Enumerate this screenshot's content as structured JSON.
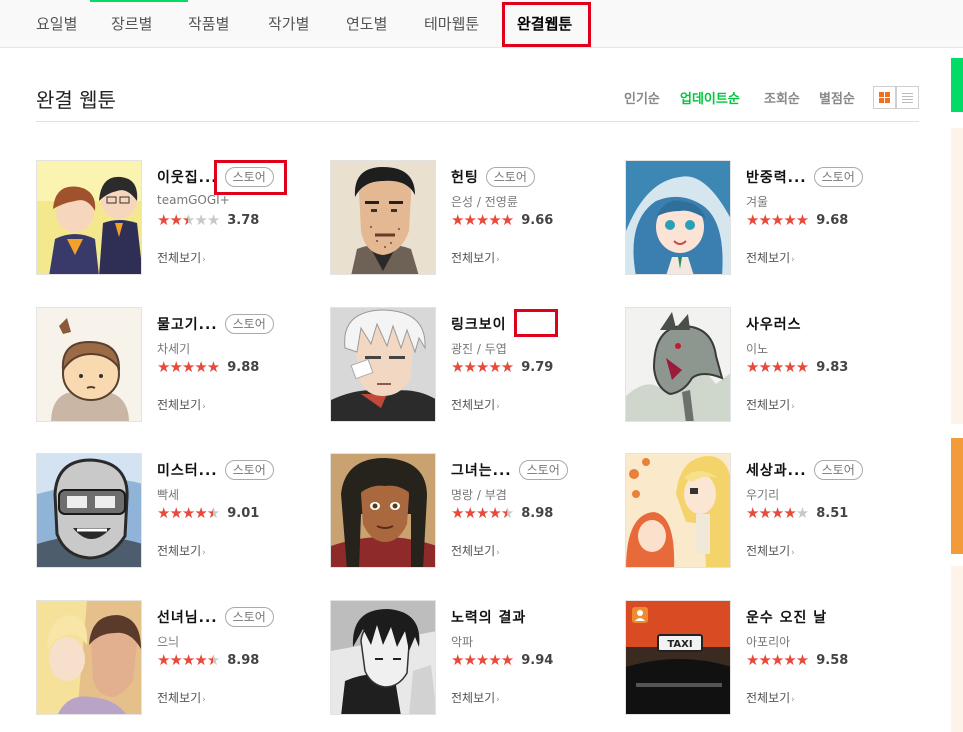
{
  "nav": {
    "tabs": [
      {
        "label": "요일별"
      },
      {
        "label": "장르별"
      },
      {
        "label": "작품별"
      },
      {
        "label": "작가별"
      },
      {
        "label": "연도별"
      },
      {
        "label": "테마웹툰"
      },
      {
        "label": "완결웹툰",
        "active": true
      }
    ],
    "accent_color": "#00dc64"
  },
  "header": {
    "title": "완결 웹툰",
    "sort_options": [
      {
        "label": "인기순"
      },
      {
        "label": "업데이트순",
        "active": true
      },
      {
        "label": "조회순"
      },
      {
        "label": "별점순"
      }
    ],
    "view_toggles": [
      "grid-view-icon",
      "list-view-icon"
    ]
  },
  "items": [
    {
      "title": "이웃집...",
      "badge": "스토어",
      "author": "teamGOGI+",
      "stars": 2.5,
      "score": "3.78",
      "view_all": "전체보기",
      "thumb": "cover-neighbors"
    },
    {
      "title": "헌팅",
      "badge": "스토어",
      "author": "은성 / 전영륜",
      "stars": 5,
      "score": "9.66",
      "view_all": "전체보기",
      "thumb": "cover-hunting"
    },
    {
      "title": "반중력...",
      "badge": "스토어",
      "author": "겨울",
      "stars": 5,
      "score": "9.68",
      "view_all": "전체보기",
      "thumb": "cover-antigravity"
    },
    {
      "title": "물고기...",
      "badge": "스토어",
      "author": "차세기",
      "stars": 5,
      "score": "9.88",
      "view_all": "전체보기",
      "thumb": "cover-fish"
    },
    {
      "title": "링크보이",
      "badge": "",
      "author": "광진 / 두엽",
      "stars": 5,
      "score": "9.79",
      "view_all": "전체보기",
      "thumb": "cover-linkboy"
    },
    {
      "title": "사우러스",
      "badge": "",
      "author": "이노",
      "stars": 5,
      "score": "9.83",
      "view_all": "전체보기",
      "thumb": "cover-saurus"
    },
    {
      "title": "미스터...",
      "badge": "스토어",
      "author": "빡세",
      "stars": 4.5,
      "score": "9.01",
      "view_all": "전체보기",
      "thumb": "cover-mister"
    },
    {
      "title": "그녀는...",
      "badge": "스토어",
      "author": "명랑 / 부겸",
      "stars": 4.5,
      "score": "8.98",
      "view_all": "전체보기",
      "thumb": "cover-she"
    },
    {
      "title": "세상과...",
      "badge": "스토어",
      "author": "우기리",
      "stars": 4,
      "score": "8.51",
      "view_all": "전체보기",
      "thumb": "cover-world"
    },
    {
      "title": "선녀님...",
      "badge": "스토어",
      "author": "으늬",
      "stars": 4.5,
      "score": "8.98",
      "view_all": "전체보기",
      "thumb": "cover-fairy"
    },
    {
      "title": "노력의 결과",
      "badge": "",
      "author": "악파",
      "stars": 5,
      "score": "9.94",
      "view_all": "전체보기",
      "thumb": "cover-effort"
    },
    {
      "title": "운수 오진 날",
      "badge": "",
      "author": "아포리아",
      "stars": 5,
      "score": "9.58",
      "view_all": "전체보기",
      "thumb": "cover-taxi"
    }
  ],
  "cover_art": {
    "taxi_sign": "TAXI"
  },
  "colors": {
    "star": "#e74a3b",
    "brand_green": "#00c73c",
    "highlight": "#e0001a"
  }
}
